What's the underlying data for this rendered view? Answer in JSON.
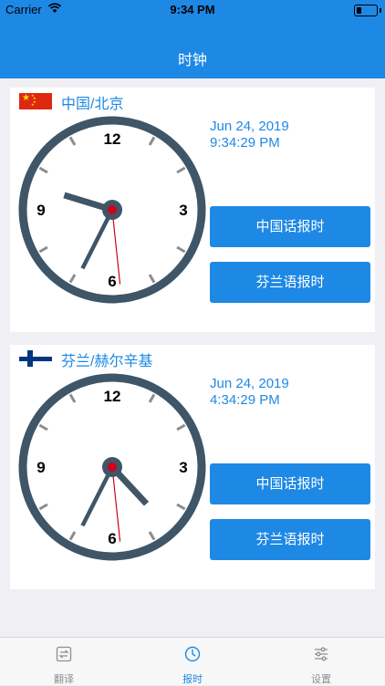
{
  "status_bar": {
    "carrier": "Carrier",
    "time": "9:34 PM"
  },
  "nav": {
    "title": "时钟"
  },
  "clocks": [
    {
      "city": "中国/北京",
      "flag": "china-flag",
      "date": "Jun 24, 2019",
      "time": "9:34:29 PM",
      "hand_time": {
        "hours": 9,
        "minutes": 34,
        "seconds": 29
      },
      "buttons": {
        "chinese": "中国话报时",
        "finnish": "芬兰语报时"
      }
    },
    {
      "city": "芬兰/赫尔辛基",
      "flag": "finland-flag",
      "date": "Jun 24, 2019",
      "time": "4:34:29 PM",
      "hand_time": {
        "hours": 4,
        "minutes": 34,
        "seconds": 29
      },
      "buttons": {
        "chinese": "中国话报时",
        "finnish": "芬兰语报时"
      }
    }
  ],
  "clock_numerals": {
    "twelve": "12",
    "three": "3",
    "six": "6",
    "nine": "9"
  },
  "tabs": [
    {
      "label": "翻译",
      "icon": "translate-icon"
    },
    {
      "label": "报时",
      "icon": "clock-icon",
      "active": true
    },
    {
      "label": "设置",
      "icon": "settings-icon"
    }
  ],
  "colors": {
    "accent": "#1e88e5",
    "clock_face": "#3f5568",
    "second_hand": "#d0021b",
    "background": "#efeff4"
  }
}
